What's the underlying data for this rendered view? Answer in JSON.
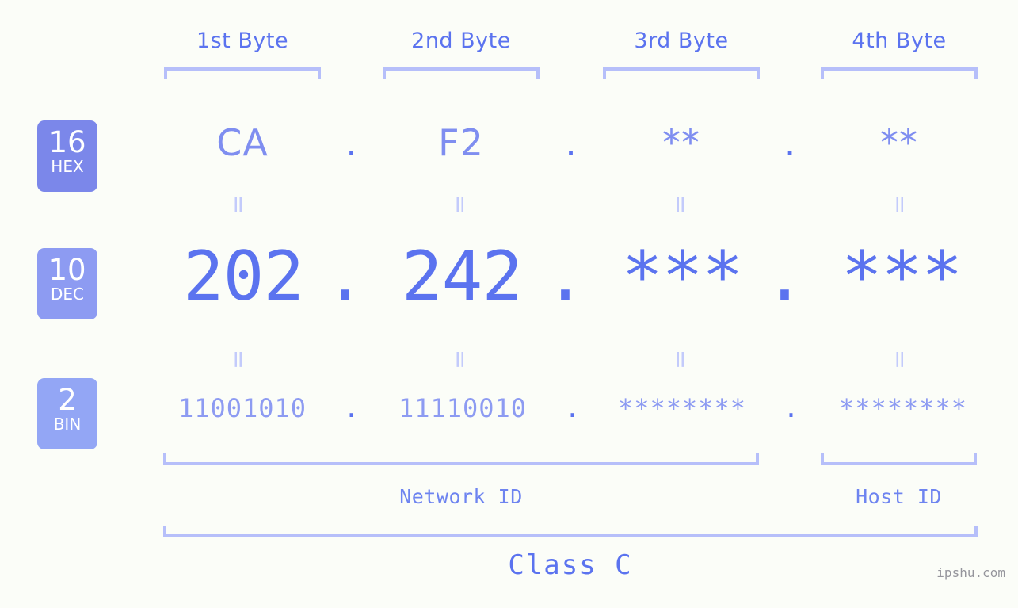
{
  "page": {
    "background_color": "#fbfdf8",
    "accent_color": "#5b73ef",
    "accent_light_color": "#b6bffa",
    "watermark": "ipshu.com"
  },
  "byte_headers": [
    {
      "label": "1st Byte"
    },
    {
      "label": "2nd Byte"
    },
    {
      "label": "3rd Byte"
    },
    {
      "label": "4th Byte"
    }
  ],
  "rows": [
    {
      "id": "hex",
      "badge_number": "16",
      "badge_name": "HEX",
      "badge_color": "#7b87ea",
      "values": [
        "CA",
        "F2",
        "**",
        "**"
      ],
      "separator": "."
    },
    {
      "id": "dec",
      "badge_number": "10",
      "badge_name": "DEC",
      "badge_color": "#8d9bf2",
      "values": [
        "202",
        "242",
        "***",
        "***"
      ],
      "separator": "."
    },
    {
      "id": "bin",
      "badge_number": "2",
      "badge_name": "BIN",
      "badge_color": "#93a6f5",
      "values": [
        "11001010",
        "11110010",
        "********",
        "********"
      ],
      "separator": "."
    }
  ],
  "equals_symbol": "=",
  "sections": [
    {
      "label": "Network ID"
    },
    {
      "label": "Host ID"
    }
  ],
  "class_label": "Class C"
}
